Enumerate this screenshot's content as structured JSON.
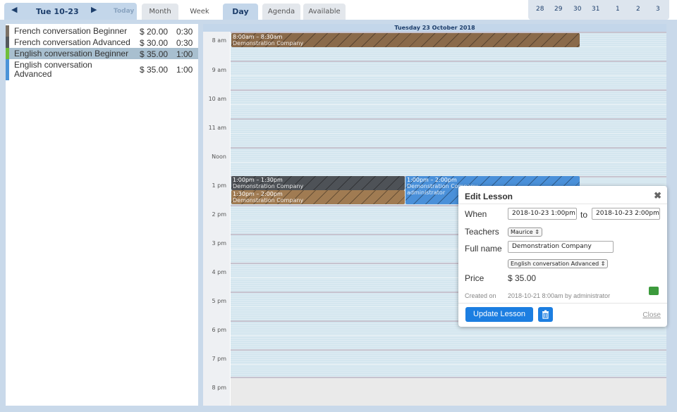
{
  "toolbar": {
    "prev_icon": "caret-left-icon",
    "date_label": "Tue 10-23",
    "next_icon": "caret-right-icon",
    "today_label": "Today",
    "tabs": [
      {
        "label": "Month",
        "active": false
      },
      {
        "label": "Week",
        "active": false
      },
      {
        "label": "Day",
        "active": true
      },
      {
        "label": "Agenda",
        "active": false
      },
      {
        "label": "Available",
        "active": false
      }
    ],
    "mini_days": [
      "28",
      "29",
      "30",
      "31",
      "1",
      "2",
      "3"
    ]
  },
  "lessons": [
    {
      "name": "French conversation Beginner",
      "price": "$ 20.00",
      "duration": "0:30",
      "color": "#7c7166",
      "selected": false
    },
    {
      "name": "French conversation Advanced",
      "price": "$ 30.00",
      "duration": "0:30",
      "color": "#55595d",
      "selected": false
    },
    {
      "name": "English conversation Beginner",
      "price": "$ 35.00",
      "duration": "1:00",
      "color": "#6fbe3b",
      "selected": true
    },
    {
      "name": "English conversation Advanced",
      "price": "$ 35.00",
      "duration": "1:00",
      "color": "#4b93d8",
      "selected": false
    }
  ],
  "calendar": {
    "header": "Tuesday 23 October 2018",
    "hours": [
      "8 am",
      "9 am",
      "10 am",
      "11 am",
      "Noon",
      "1 pm",
      "2 pm",
      "3 pm",
      "4 pm",
      "5 pm",
      "6 pm",
      "7 pm",
      "8 pm"
    ],
    "events": [
      {
        "time": "8:00am – 8:30am",
        "title": "Demonstration Company",
        "extra": "",
        "color": "#8a6a4a"
      },
      {
        "time": "1:00pm – 1:30pm",
        "title": "Demonstration Company",
        "extra": "",
        "color": "#4e5257"
      },
      {
        "time": "1:30pm – 2:00pm",
        "title": "Demonstration Company",
        "extra": "",
        "color": "#a07b52"
      },
      {
        "time": "1:00pm – 2:00pm",
        "title": "Demonstration Company",
        "extra": "administrator",
        "color": "#4a90d9"
      }
    ]
  },
  "popup": {
    "title": "Edit Lesson",
    "when_label": "When",
    "from_value": "2018-10-23 1:00pm",
    "to_label": "to",
    "to_value": "2018-10-23 2:00pm",
    "teachers_label": "Teachers",
    "teacher_value": "Maurice",
    "fullname_label": "Full name",
    "fullname_value": "Demonstration Company",
    "lesson_value": "English conversation Advanced",
    "price_label": "Price",
    "price_value": "$ 35.00",
    "created_label": "Created on",
    "created_value": "2018-10-21 8:00am by administrator",
    "update_label": "Update Lesson",
    "close_label": "Close"
  }
}
